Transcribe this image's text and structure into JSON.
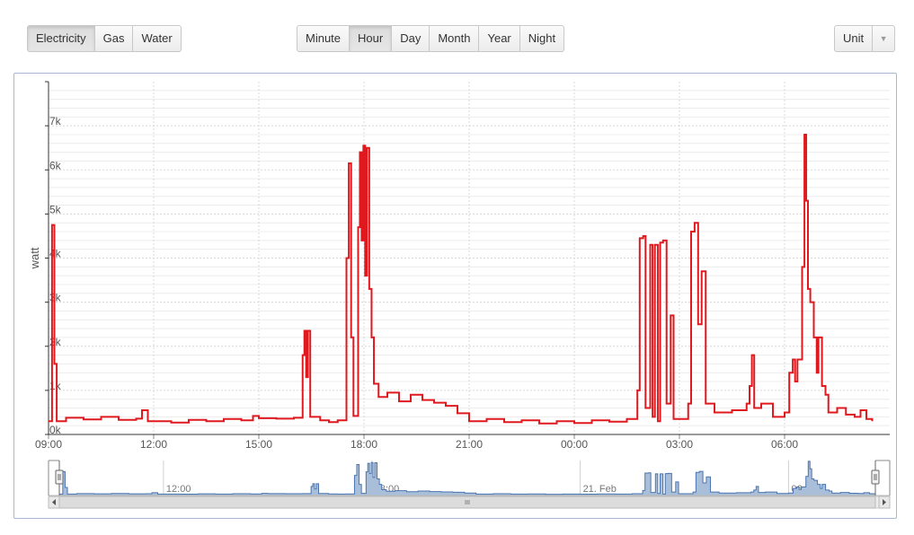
{
  "toolbar": {
    "type_buttons": [
      {
        "label": "Electricity",
        "active": true
      },
      {
        "label": "Gas",
        "active": false
      },
      {
        "label": "Water",
        "active": false
      }
    ],
    "period_buttons": [
      {
        "label": "Minute",
        "active": false
      },
      {
        "label": "Hour",
        "active": true
      },
      {
        "label": "Day",
        "active": false
      },
      {
        "label": "Month",
        "active": false
      },
      {
        "label": "Year",
        "active": false
      },
      {
        "label": "Night",
        "active": false
      }
    ],
    "unit_label": "Unit",
    "unit_caret_icon": "caret-down-icon"
  },
  "colors": {
    "series": "#e0191e",
    "navigator_fill": "#a9bfd9",
    "navigator_line": "#4a74b0",
    "grid": "#d8d8d8"
  },
  "chart_data": {
    "type": "line",
    "ylabel": "watt",
    "ylim": [
      0,
      8000
    ],
    "y_ticks": [
      "0k",
      "1k",
      "2k",
      "3k",
      "4k",
      "5k",
      "6k",
      "7k"
    ],
    "x_range": [
      "20 Feb 09:00",
      "21 Feb 08:30"
    ],
    "x_ticks": [
      "09:00",
      "12:00",
      "15:00",
      "18:00",
      "21:00",
      "00:00",
      "03:00",
      "06:00"
    ],
    "navigator_ticks": [
      "12:00",
      "18:00",
      "21. Feb",
      "06:00"
    ],
    "series": [
      {
        "values": [
          {
            "t": "20 Feb 09:00",
            "w": 300
          },
          {
            "t": "20 Feb 09:06",
            "w": 4750
          },
          {
            "t": "20 Feb 09:10",
            "w": 1600
          },
          {
            "t": "20 Feb 09:14",
            "w": 300
          },
          {
            "t": "20 Feb 09:30",
            "w": 380
          },
          {
            "t": "20 Feb 10:00",
            "w": 340
          },
          {
            "t": "20 Feb 10:30",
            "w": 400
          },
          {
            "t": "20 Feb 11:00",
            "w": 330
          },
          {
            "t": "20 Feb 11:30",
            "w": 360
          },
          {
            "t": "20 Feb 11:40",
            "w": 550
          },
          {
            "t": "20 Feb 11:50",
            "w": 300
          },
          {
            "t": "20 Feb 12:30",
            "w": 270
          },
          {
            "t": "20 Feb 13:00",
            "w": 330
          },
          {
            "t": "20 Feb 13:30",
            "w": 300
          },
          {
            "t": "20 Feb 14:00",
            "w": 350
          },
          {
            "t": "20 Feb 14:30",
            "w": 320
          },
          {
            "t": "20 Feb 14:50",
            "w": 420
          },
          {
            "t": "20 Feb 15:00",
            "w": 370
          },
          {
            "t": "20 Feb 15:30",
            "w": 360
          },
          {
            "t": "20 Feb 16:00",
            "w": 380
          },
          {
            "t": "20 Feb 16:15",
            "w": 1800
          },
          {
            "t": "20 Feb 16:18",
            "w": 2350
          },
          {
            "t": "20 Feb 16:21",
            "w": 1300
          },
          {
            "t": "20 Feb 16:24",
            "w": 2350
          },
          {
            "t": "20 Feb 16:28",
            "w": 400
          },
          {
            "t": "20 Feb 16:45",
            "w": 320
          },
          {
            "t": "20 Feb 17:00",
            "w": 280
          },
          {
            "t": "20 Feb 17:15",
            "w": 320
          },
          {
            "t": "20 Feb 17:30",
            "w": 4000
          },
          {
            "t": "20 Feb 17:34",
            "w": 6150
          },
          {
            "t": "20 Feb 17:38",
            "w": 2200
          },
          {
            "t": "20 Feb 17:42",
            "w": 420
          },
          {
            "t": "20 Feb 17:50",
            "w": 4700
          },
          {
            "t": "20 Feb 17:53",
            "w": 6400
          },
          {
            "t": "20 Feb 17:56",
            "w": 4400
          },
          {
            "t": "20 Feb 17:59",
            "w": 6550
          },
          {
            "t": "20 Feb 18:02",
            "w": 3600
          },
          {
            "t": "20 Feb 18:05",
            "w": 6500
          },
          {
            "t": "20 Feb 18:09",
            "w": 3300
          },
          {
            "t": "20 Feb 18:13",
            "w": 2200
          },
          {
            "t": "20 Feb 18:17",
            "w": 1150
          },
          {
            "t": "20 Feb 18:25",
            "w": 850
          },
          {
            "t": "20 Feb 18:40",
            "w": 950
          },
          {
            "t": "20 Feb 19:00",
            "w": 750
          },
          {
            "t": "20 Feb 19:20",
            "w": 900
          },
          {
            "t": "20 Feb 19:40",
            "w": 780
          },
          {
            "t": "20 Feb 20:00",
            "w": 720
          },
          {
            "t": "20 Feb 20:20",
            "w": 650
          },
          {
            "t": "20 Feb 20:40",
            "w": 480
          },
          {
            "t": "20 Feb 21:00",
            "w": 300
          },
          {
            "t": "20 Feb 21:30",
            "w": 350
          },
          {
            "t": "20 Feb 22:00",
            "w": 280
          },
          {
            "t": "20 Feb 22:30",
            "w": 320
          },
          {
            "t": "20 Feb 23:00",
            "w": 250
          },
          {
            "t": "20 Feb 23:30",
            "w": 300
          },
          {
            "t": "21 Feb 00:00",
            "w": 260
          },
          {
            "t": "21 Feb 00:30",
            "w": 320
          },
          {
            "t": "21 Feb 01:00",
            "w": 290
          },
          {
            "t": "21 Feb 01:30",
            "w": 350
          },
          {
            "t": "21 Feb 01:48",
            "w": 1000
          },
          {
            "t": "21 Feb 01:52",
            "w": 4450
          },
          {
            "t": "21 Feb 01:58",
            "w": 4500
          },
          {
            "t": "21 Feb 02:02",
            "w": 600
          },
          {
            "t": "21 Feb 02:10",
            "w": 4300
          },
          {
            "t": "21 Feb 02:14",
            "w": 400
          },
          {
            "t": "21 Feb 02:18",
            "w": 4300
          },
          {
            "t": "21 Feb 02:23",
            "w": 300
          },
          {
            "t": "21 Feb 02:27",
            "w": 4350
          },
          {
            "t": "21 Feb 02:32",
            "w": 4400
          },
          {
            "t": "21 Feb 02:38",
            "w": 700
          },
          {
            "t": "21 Feb 02:45",
            "w": 2700
          },
          {
            "t": "21 Feb 02:50",
            "w": 350
          },
          {
            "t": "21 Feb 03:00",
            "w": 350
          },
          {
            "t": "21 Feb 03:15",
            "w": 700
          },
          {
            "t": "21 Feb 03:20",
            "w": 4600
          },
          {
            "t": "21 Feb 03:26",
            "w": 4800
          },
          {
            "t": "21 Feb 03:32",
            "w": 2500
          },
          {
            "t": "21 Feb 03:38",
            "w": 3700
          },
          {
            "t": "21 Feb 03:45",
            "w": 700
          },
          {
            "t": "21 Feb 04:00",
            "w": 500
          },
          {
            "t": "21 Feb 04:30",
            "w": 550
          },
          {
            "t": "21 Feb 04:55",
            "w": 700
          },
          {
            "t": "21 Feb 05:00",
            "w": 1100
          },
          {
            "t": "21 Feb 05:04",
            "w": 1800
          },
          {
            "t": "21 Feb 05:08",
            "w": 600
          },
          {
            "t": "21 Feb 05:20",
            "w": 700
          },
          {
            "t": "21 Feb 05:40",
            "w": 400
          },
          {
            "t": "21 Feb 06:00",
            "w": 500
          },
          {
            "t": "21 Feb 06:08",
            "w": 1400
          },
          {
            "t": "21 Feb 06:14",
            "w": 1700
          },
          {
            "t": "21 Feb 06:18",
            "w": 1200
          },
          {
            "t": "21 Feb 06:22",
            "w": 1700
          },
          {
            "t": "21 Feb 06:30",
            "w": 3800
          },
          {
            "t": "21 Feb 06:34",
            "w": 6800
          },
          {
            "t": "21 Feb 06:37",
            "w": 5300
          },
          {
            "t": "21 Feb 06:40",
            "w": 3300
          },
          {
            "t": "21 Feb 06:44",
            "w": 3000
          },
          {
            "t": "21 Feb 06:50",
            "w": 2200
          },
          {
            "t": "21 Feb 06:55",
            "w": 1400
          },
          {
            "t": "21 Feb 06:58",
            "w": 2200
          },
          {
            "t": "21 Feb 07:04",
            "w": 1100
          },
          {
            "t": "21 Feb 07:10",
            "w": 900
          },
          {
            "t": "21 Feb 07:15",
            "w": 500
          },
          {
            "t": "21 Feb 07:30",
            "w": 600
          },
          {
            "t": "21 Feb 07:45",
            "w": 450
          },
          {
            "t": "21 Feb 08:00",
            "w": 400
          },
          {
            "t": "21 Feb 08:10",
            "w": 550
          },
          {
            "t": "21 Feb 08:20",
            "w": 350
          },
          {
            "t": "21 Feb 08:30",
            "w": 300
          }
        ]
      }
    ]
  }
}
